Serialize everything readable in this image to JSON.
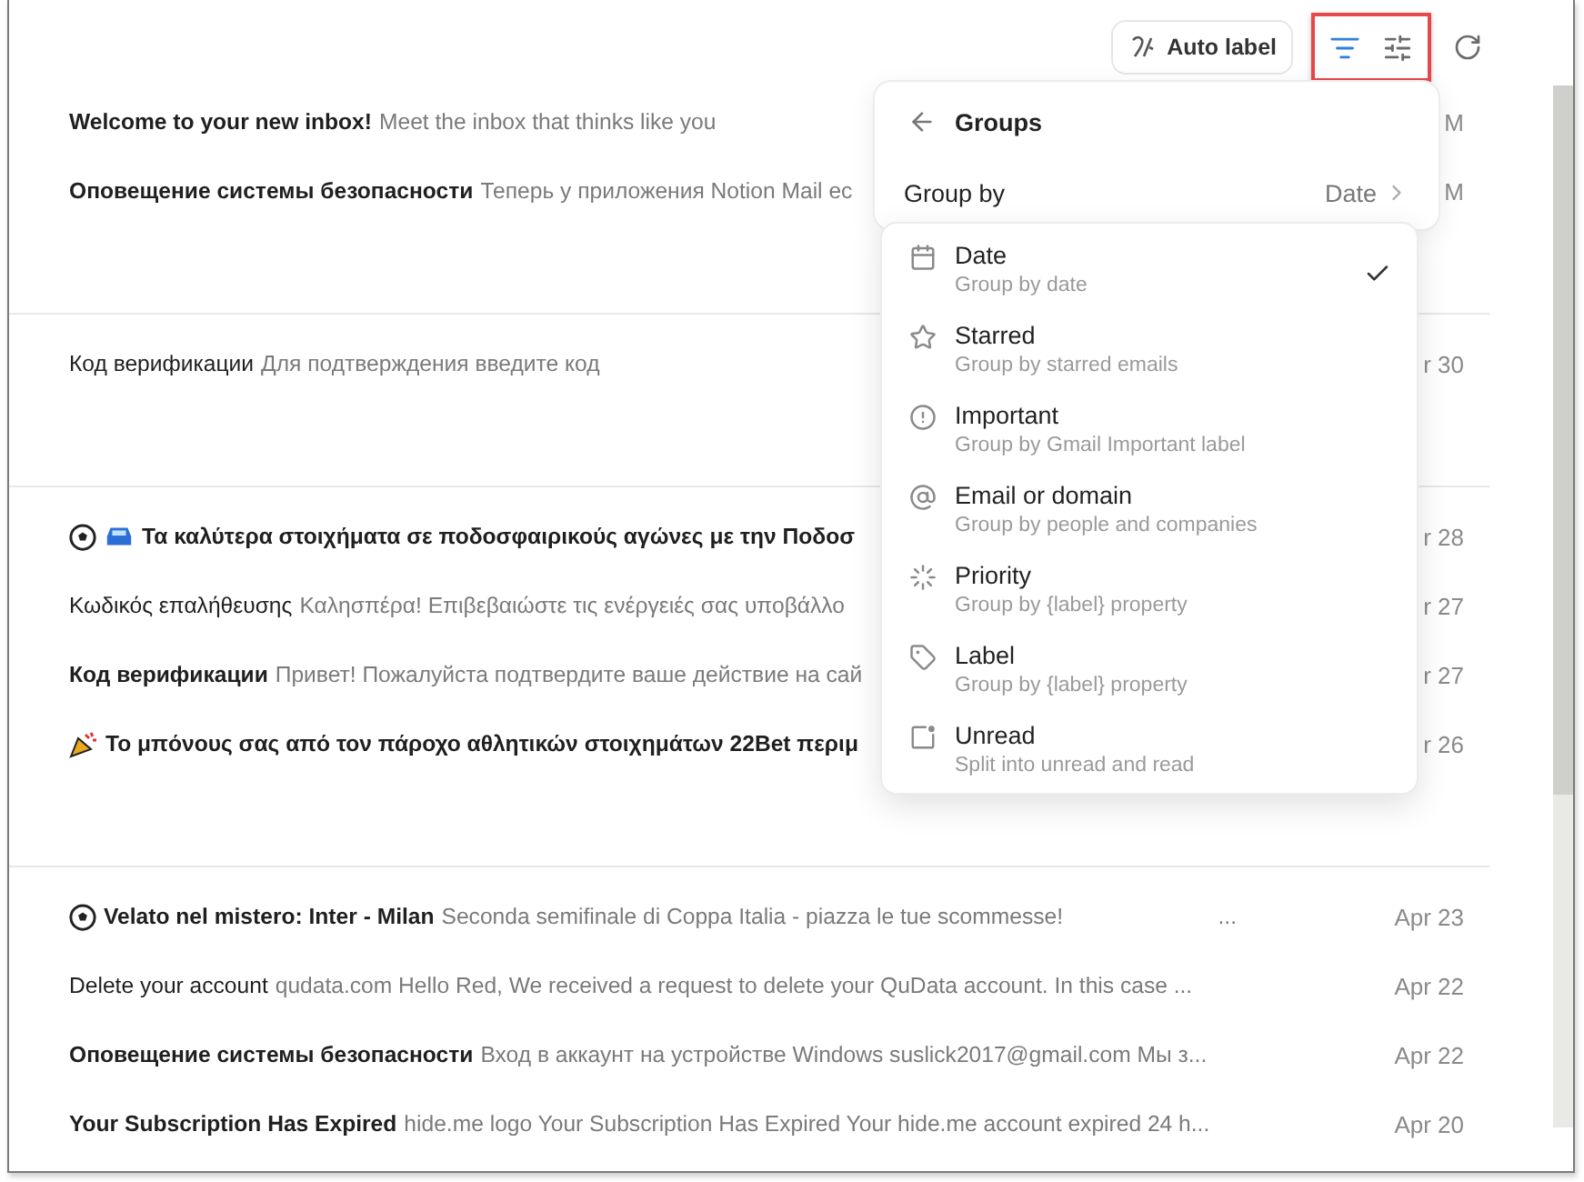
{
  "toolbar": {
    "auto_label": "Auto label",
    "buttons": [
      {
        "kind": "group",
        "selected": true
      },
      {
        "kind": "filter",
        "selected": false
      },
      {
        "kind": "refresh",
        "selected": false
      }
    ]
  },
  "email_groups": [
    {
      "rows": [
        {
          "kind": "plain",
          "subject": "Welcome to your new inbox!",
          "preview": "Meet the inbox that thinks like you",
          "date": "M",
          "unread": true
        },
        {
          "kind": "plain",
          "subject": "Оповещение системы безопасности",
          "preview": "Теперь у приложения Notion Mail ec",
          "date": "M",
          "unread": true
        }
      ]
    },
    {
      "rows": [
        {
          "kind": "plain",
          "subject": "Код верификации",
          "preview": "Для подтверждения введите код",
          "date": "r 30",
          "unread": false
        }
      ]
    },
    {
      "rows": [
        {
          "kind": "promo",
          "subject": "Τα καλύτερα στοιχήματα σε ποδοσφαιρικούς αγώνες με την Ποδοσ",
          "date": "r 28",
          "unread": true
        },
        {
          "kind": "plain",
          "subject": "Κωδικός επαλήθευσης",
          "preview": "Καλησπέρα! Επιβεβαιώστε τις ενέργειές σας υποβάλλο",
          "date": "r 27",
          "unread": false
        },
        {
          "kind": "plain",
          "subject": "Код верификации",
          "preview": "Привет! Пожалуйста подтвердите ваше действие на сай",
          "date": "r 27",
          "unread": true
        },
        {
          "kind": "bonus",
          "subject": "Το μπόνους σας από τον πάροχο αθλητικών στοιχημάτων 22Bet περιμ",
          "date": "r 26",
          "unread": true
        }
      ]
    },
    {
      "rows": [
        {
          "kind": "football",
          "subject": "Velato nel mistero: Inter - Milan",
          "preview": "Seconda semifinale di Coppa Italia - piazza le tue scommesse!",
          "more": "...",
          "date": "Apr 23",
          "unread": true
        },
        {
          "kind": "plain",
          "subject": "Delete your account",
          "preview": "qudata.com Hello Red, We received a request to delete your QuData account. In this case ...",
          "date": "Apr 22",
          "unread": false
        },
        {
          "kind": "plain",
          "subject": "Оповещение системы безопасности",
          "preview": "Вход в аккаунт на устройстве Windows suslick2017@gmail.com Мы з...",
          "date": "Apr 22",
          "unread": true
        },
        {
          "kind": "plain",
          "subject": "Your Subscription Has Expired",
          "preview": "hide.me logo Your Subscription Has Expired Your hide.me account expired 24 h...",
          "date": "Apr 20",
          "unread": true
        }
      ]
    }
  ],
  "groups_panel": {
    "title": "Groups",
    "group_by": {
      "label": "Group by",
      "value": "Date"
    }
  },
  "group_menu": [
    {
      "kind": "date",
      "title": "Date",
      "subtitle": "Group by date",
      "selected": true
    },
    {
      "kind": "starred",
      "title": "Starred",
      "subtitle": "Group by starred emails",
      "selected": false
    },
    {
      "kind": "important",
      "title": "Important",
      "subtitle": "Group by Gmail Important label",
      "selected": false
    },
    {
      "kind": "email",
      "title": "Email or domain",
      "subtitle": "Group by people and companies",
      "selected": false
    },
    {
      "kind": "priority",
      "title": "Priority",
      "subtitle": "Group by {label} property",
      "selected": false
    },
    {
      "kind": "label",
      "title": "Label",
      "subtitle": "Group by {label} property",
      "selected": false
    },
    {
      "kind": "unread",
      "title": "Unread",
      "subtitle": "Split into unread and read",
      "selected": false
    }
  ]
}
